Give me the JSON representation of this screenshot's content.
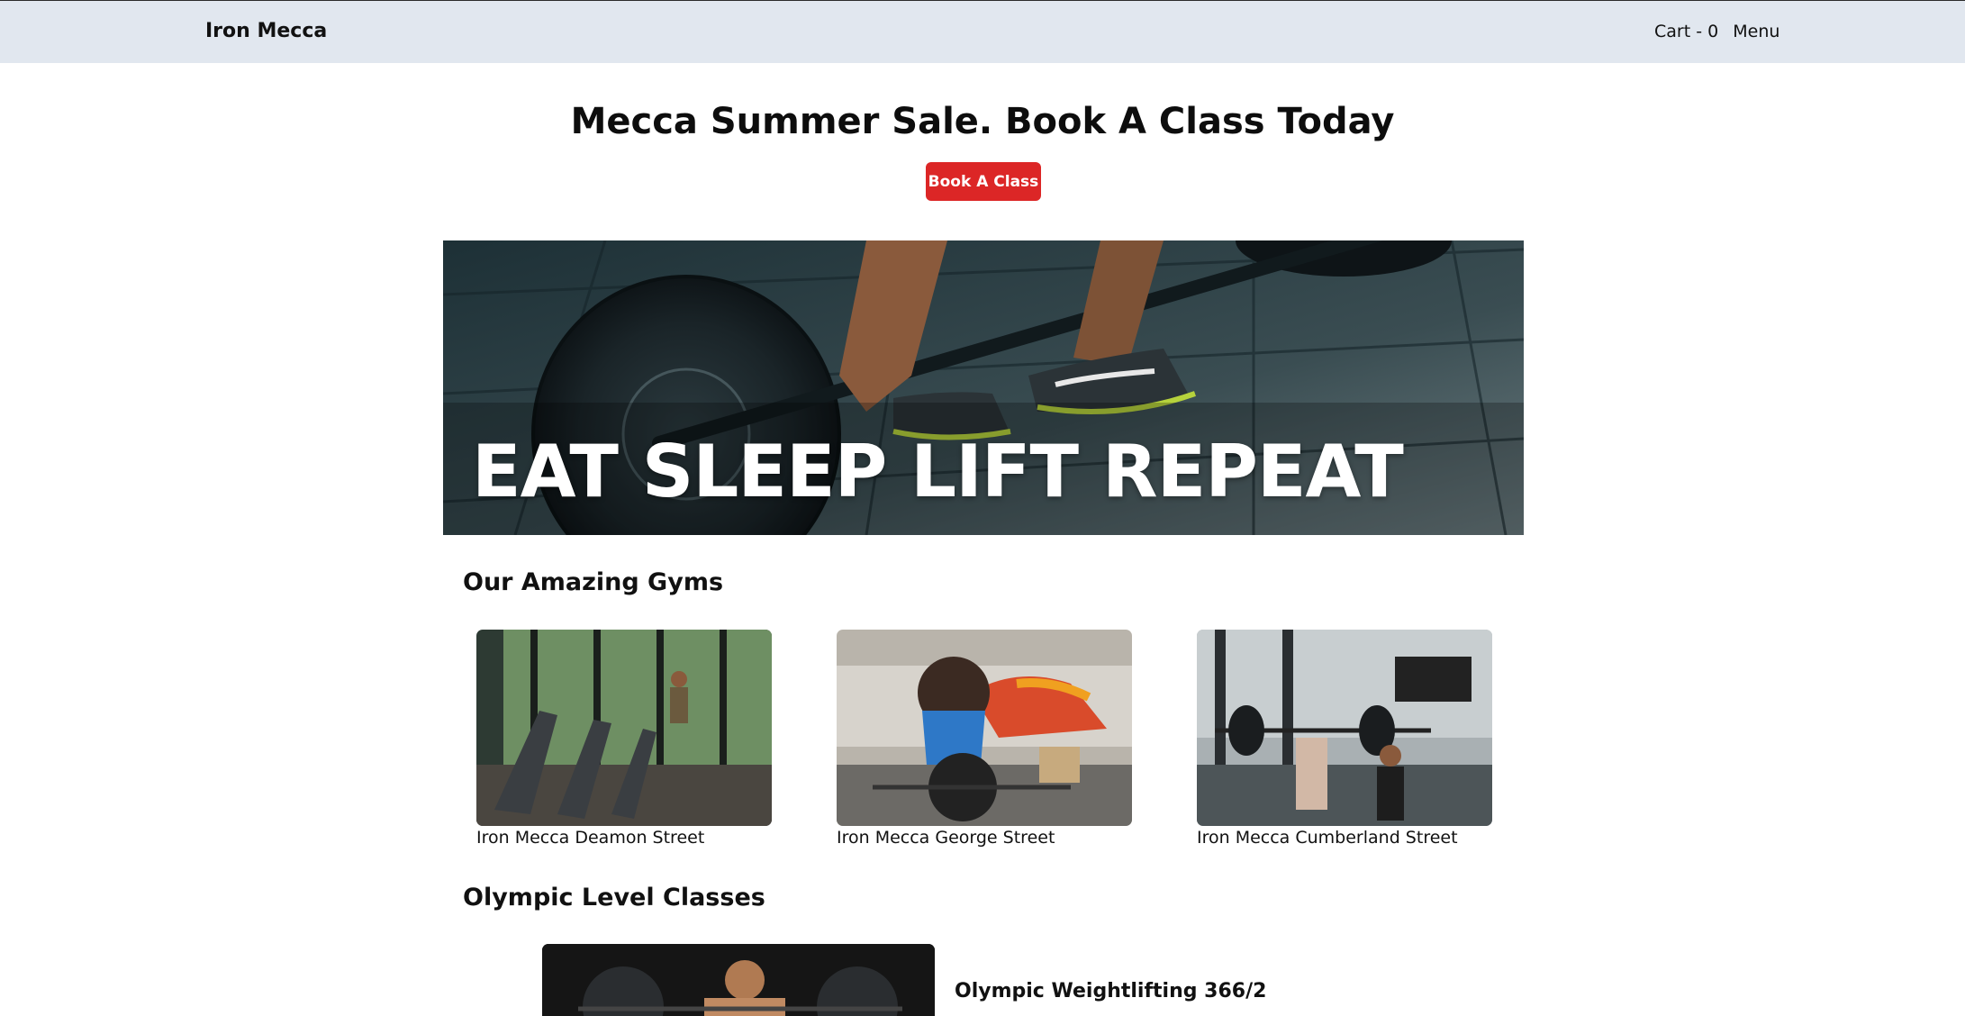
{
  "navbar": {
    "brand": "Iron Mecca",
    "cart_label": "Cart - 0",
    "menu_label": "Menu"
  },
  "hero": {
    "title": "Mecca Summer Sale. Book A Class Today",
    "button_label": "Book A Class"
  },
  "banner": {
    "slogan": "EAT SLEEP LIFT REPEAT"
  },
  "gyms": {
    "title": "Our Amazing Gyms",
    "items": [
      {
        "name": "Iron Mecca Deamon Street"
      },
      {
        "name": "Iron Mecca George Street"
      },
      {
        "name": "Iron Mecca Cumberland Street"
      }
    ]
  },
  "classes": {
    "title": "Olympic Level Classes",
    "items": [
      {
        "name": "Olympic Weightlifting 366/2"
      }
    ]
  },
  "colors": {
    "navbar_bg": "#e1e7ef",
    "accent": "#dc2626"
  }
}
